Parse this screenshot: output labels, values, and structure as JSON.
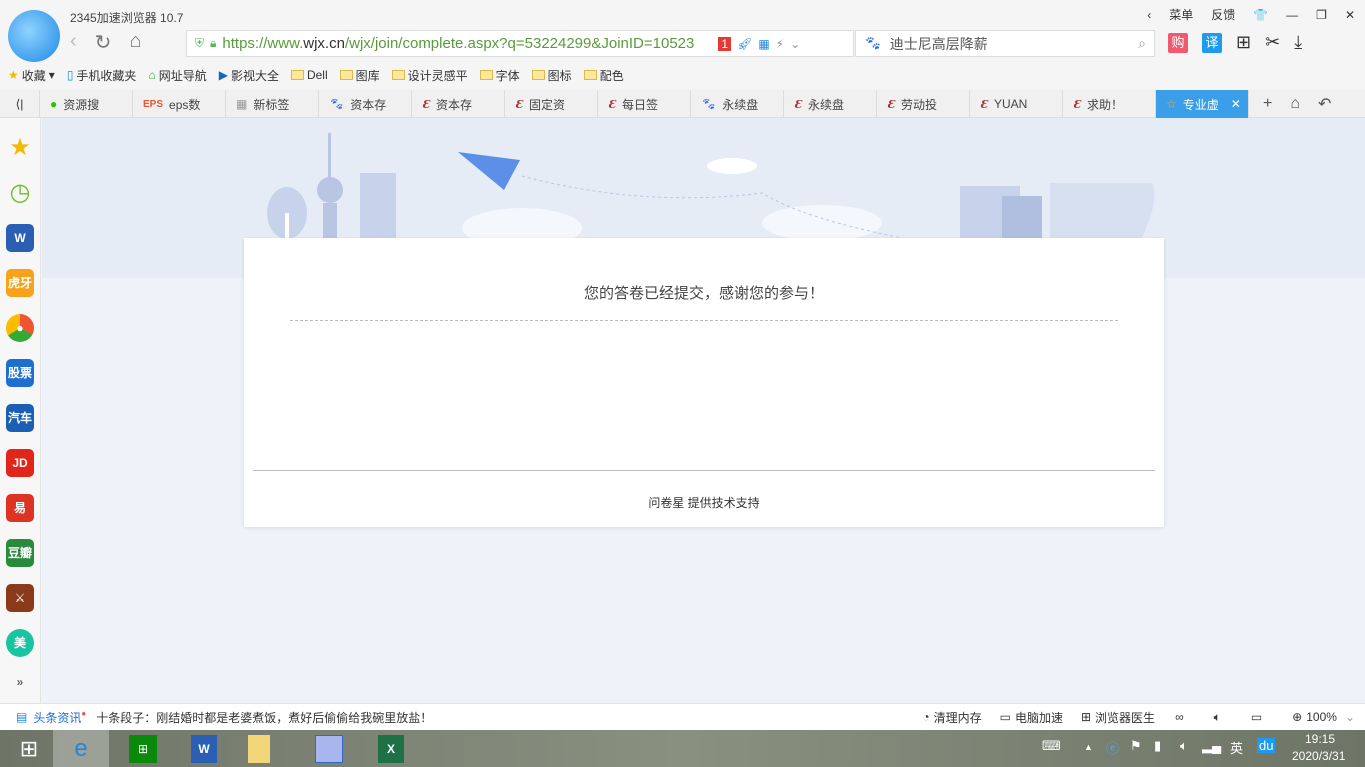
{
  "window": {
    "title": "2345加速浏览器 10.7",
    "menu": "菜单",
    "feedback": "反馈"
  },
  "address": {
    "url_prefix": "https://www.",
    "url_domain": "wjx.cn",
    "url_rest": "/wjx/join/complete.aspx?q=53224299&JoinID=10523",
    "badge": "1"
  },
  "search": {
    "placeholder": "迪士尼高层降薪"
  },
  "tools": {
    "shop": "购",
    "translate": "译"
  },
  "bookmarks": [
    {
      "label": "收藏"
    },
    {
      "label": "手机收藏夹"
    },
    {
      "label": "网址导航"
    },
    {
      "label": "影视大全"
    },
    {
      "label": "Dell"
    },
    {
      "label": "图库"
    },
    {
      "label": "设计灵感平"
    },
    {
      "label": "字体"
    },
    {
      "label": "图标"
    },
    {
      "label": "配色"
    }
  ],
  "tabs": [
    {
      "label": "资源搜"
    },
    {
      "label": "eps数"
    },
    {
      "label": "新标签"
    },
    {
      "label": "资本存"
    },
    {
      "label": "资本存"
    },
    {
      "label": "固定资"
    },
    {
      "label": "每日签"
    },
    {
      "label": "永续盘"
    },
    {
      "label": "永续盘"
    },
    {
      "label": "劳动投"
    },
    {
      "label": "YUAN"
    },
    {
      "label": "求助！"
    },
    {
      "label": "专业虚"
    }
  ],
  "sidebar": {
    "huya": "虎牙",
    "stock": "股票",
    "car": "汽车",
    "jd": "JD",
    "yi": "易",
    "douban": "豆瓣",
    "mei": "美"
  },
  "page": {
    "message": "您的答卷已经提交，感谢您的参与！",
    "support": "问卷星 提供技术支持"
  },
  "status": {
    "news_label": "头条资讯",
    "news_text": "十条段子：刚结婚时都是老婆煮饭，煮好后偷偷给我碗里放盐！",
    "clean": "清理内存",
    "speed": "电脑加速",
    "doctor": "浏览器医生",
    "zoom": "100%"
  },
  "taskbar": {
    "time": "19:15",
    "date": "2020/3/31",
    "ime": "英",
    "du": "du"
  }
}
